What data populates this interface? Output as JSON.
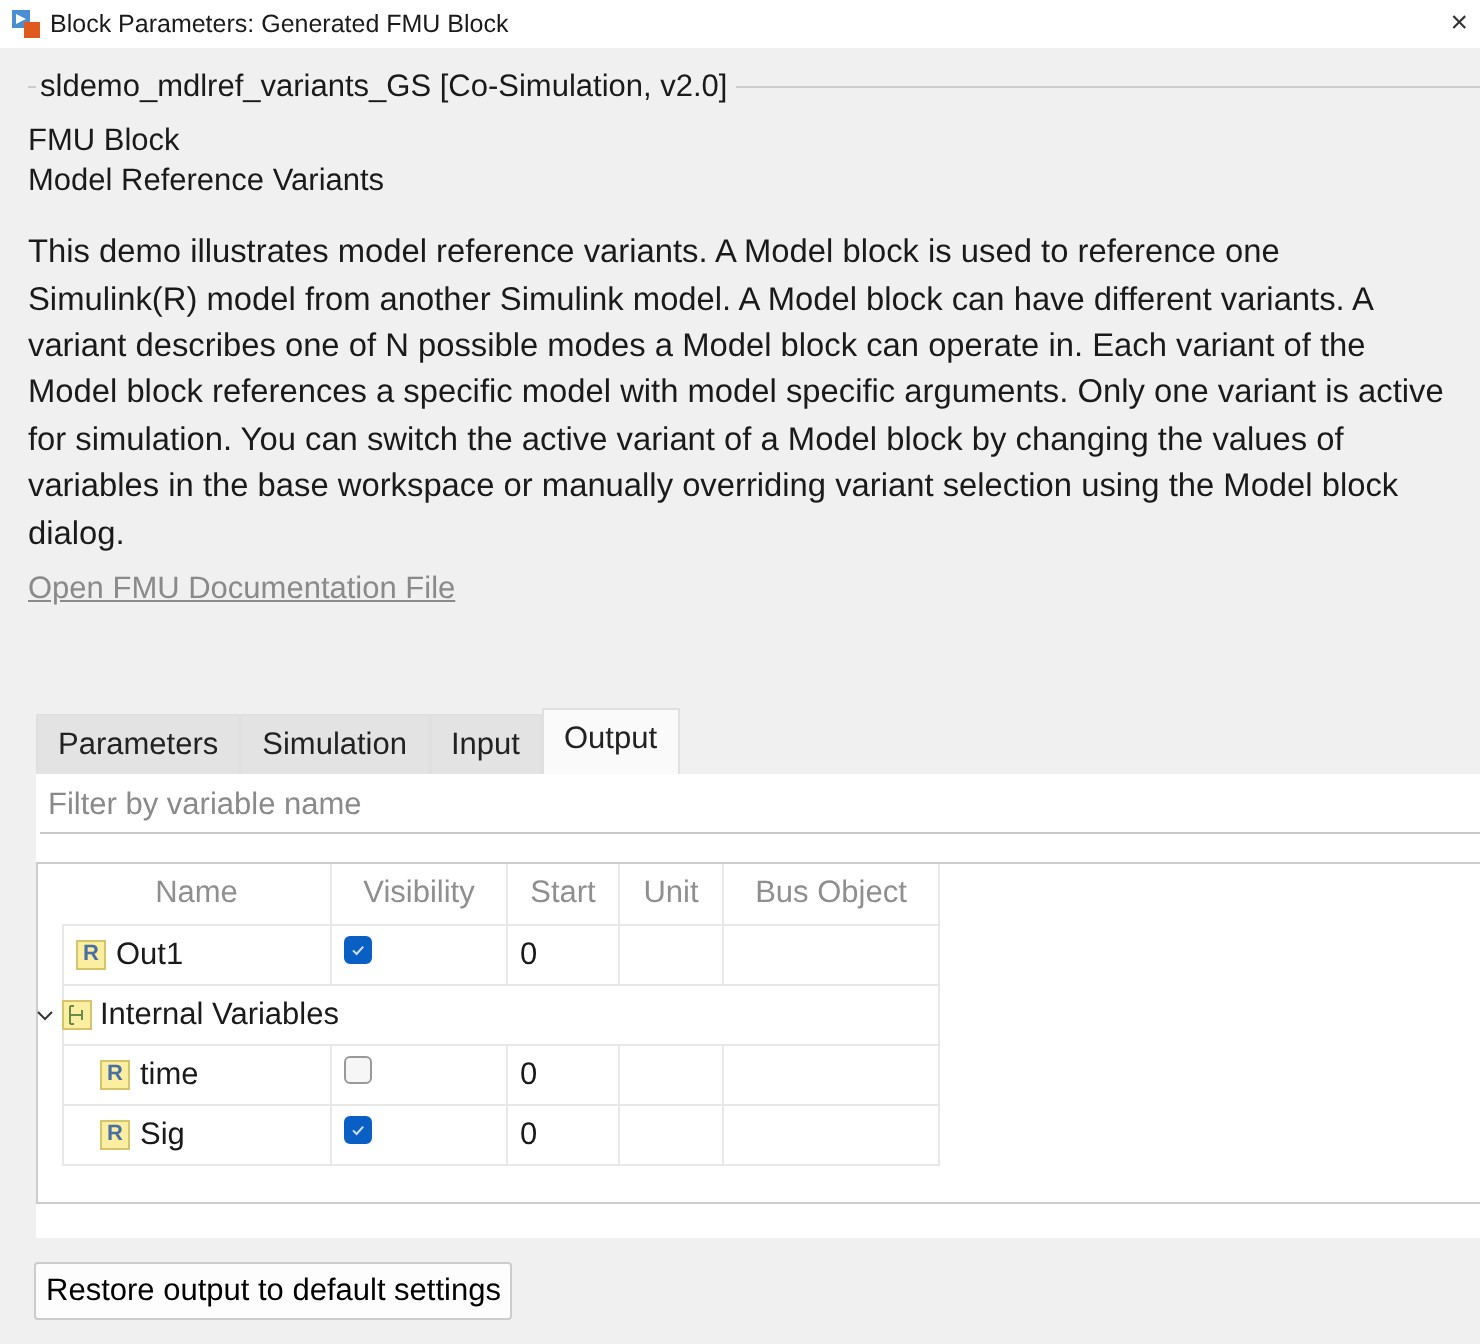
{
  "window": {
    "title": "Block Parameters: Generated FMU Block",
    "close": "×"
  },
  "group_title": "sldemo_mdlref_variants_GS [Co-Simulation, v2.0]",
  "block_type": "FMU Block",
  "block_name": "Model Reference Variants",
  "description": "This demo illustrates model reference variants. A Model block is used to reference one Simulink(R) model from another Simulink model. A Model block can have different variants. A variant describes one of N possible modes a Model block can operate in. Each variant of the Model block references a specific model with model specific arguments. Only one variant is active for simulation. You can switch the active variant of a Model block by changing the values of variables in the base workspace or manually overriding variant selection using the Model block dialog.",
  "doc_link": "Open FMU Documentation File",
  "tabs": [
    {
      "label": "Parameters",
      "selected": false
    },
    {
      "label": "Simulation",
      "selected": false
    },
    {
      "label": "Input",
      "selected": false
    },
    {
      "label": "Output",
      "selected": true
    }
  ],
  "filter": {
    "placeholder": "Filter by variable name"
  },
  "table": {
    "columns": [
      "Name",
      "Visibility",
      "Start",
      "Unit",
      "Bus Object"
    ],
    "rows": [
      {
        "kind": "variable",
        "icon": "R",
        "name": "Out1",
        "visible": true,
        "start": "0"
      },
      {
        "kind": "group",
        "name": "Internal Variables",
        "expanded": true,
        "children": [
          {
            "kind": "variable",
            "icon": "R",
            "name": "time",
            "visible": false,
            "start": "0"
          },
          {
            "kind": "variable",
            "icon": "R",
            "name": "Sig",
            "visible": true,
            "start": "0"
          }
        ]
      }
    ]
  },
  "restore_button": "Restore output to default settings"
}
